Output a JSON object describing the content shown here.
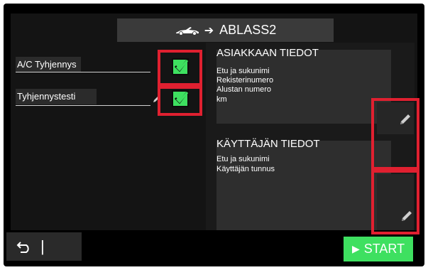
{
  "header": {
    "title": "ABLASS2",
    "car_icon": "car-convertible-icon",
    "arrow_icon": "arrow-right-icon"
  },
  "toggles": [
    {
      "label": "A/C Tyhjennys",
      "checked": true
    },
    {
      "label": "Tyhjennystesti",
      "checked": true
    }
  ],
  "customer_panel": {
    "heading": "ASIAKKAAN TIEDOT",
    "lines": [
      "Etu ja sukunimi",
      "Rekisterinumero",
      "Alustan numero",
      "km"
    ]
  },
  "user_panel": {
    "heading": "KÄYTTÄJÄN TIEDOT",
    "lines": [
      "Etu ja sukunimi",
      "Käyttäjän tunnus"
    ]
  },
  "bottom": {
    "back_icon": "undo-back-icon",
    "separator": "|",
    "start_label": "START",
    "start_icon": "play-triangle-icon"
  },
  "colors": {
    "accent_green": "#3ee060",
    "highlight_red": "#e02030",
    "background": "#141414"
  }
}
